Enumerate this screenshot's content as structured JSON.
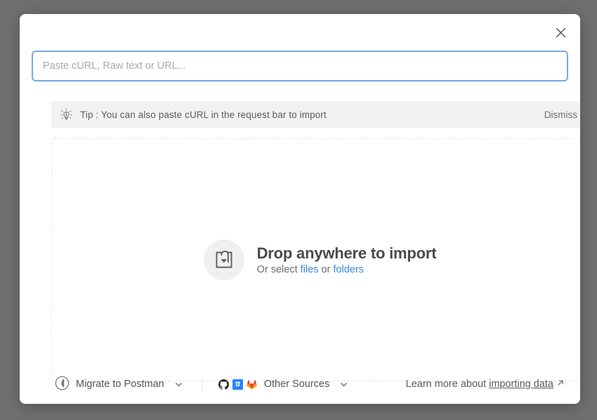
{
  "modal": {
    "close_icon": "close-icon",
    "input": {
      "placeholder": "Paste cURL, Raw text or URL...",
      "value": ""
    },
    "tip": {
      "icon": "lightbulb-icon",
      "text": "Tip : You can also paste cURL in the request bar to import",
      "dismiss_label": "Dismiss"
    },
    "dropzone": {
      "icon": "import-box-arrow-icon",
      "title": "Drop anywhere to import",
      "sub_prefix": "Or select ",
      "files_label": "files",
      "sub_joiner": " or ",
      "folders_label": "folders"
    },
    "footer": {
      "migrate_label": "Migrate to Postman",
      "migrate_icon": "postman-circle-icon",
      "migrate_chevron": "chevron-down-icon",
      "other_sources_label": "Other Sources",
      "other_sources_chevron": "chevron-down-icon",
      "source_icons": [
        "github-icon",
        "bitbucket-icon",
        "gitlab-icon"
      ],
      "learn_more_prefix": "Learn more about ",
      "learn_more_link": "importing data",
      "learn_more_external_icon": "external-link-icon"
    }
  },
  "colors": {
    "overlay": "#707070",
    "modal_bg": "#ffffff",
    "input_focus_border": "#73a9e6",
    "tip_bg": "#f2f2f2",
    "link_blue": "#3c87d6",
    "dropzone_border": "#e4e4e4"
  }
}
